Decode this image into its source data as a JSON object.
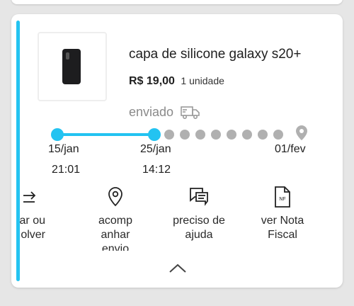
{
  "order": {
    "product_title": "capa de silicone galaxy s20+",
    "price": "R$ 19,00",
    "quantity": "1 unidade",
    "status": "enviado"
  },
  "timeline": {
    "progress_steps_completed": 2,
    "dates": [
      {
        "date": "15/jan",
        "time": "21:01"
      },
      {
        "date": "25/jan",
        "time": "14:12"
      },
      {
        "date": "01/fev",
        "time": ""
      }
    ]
  },
  "actions": [
    {
      "label": "ar ou\nolver",
      "icon": "return-icon"
    },
    {
      "label": "acomp\nanhar\nenvio",
      "icon": "location-pin-icon"
    },
    {
      "label": "preciso de\najuda",
      "icon": "chat-help-icon"
    },
    {
      "label": "ver Nota\nFiscal",
      "icon": "invoice-icon",
      "icon_text": "NF"
    }
  ],
  "colors": {
    "accent": "#23c3f1",
    "pending": "#b0b0b0",
    "text": "#1f1f1f",
    "muted": "#8a8a8a"
  }
}
